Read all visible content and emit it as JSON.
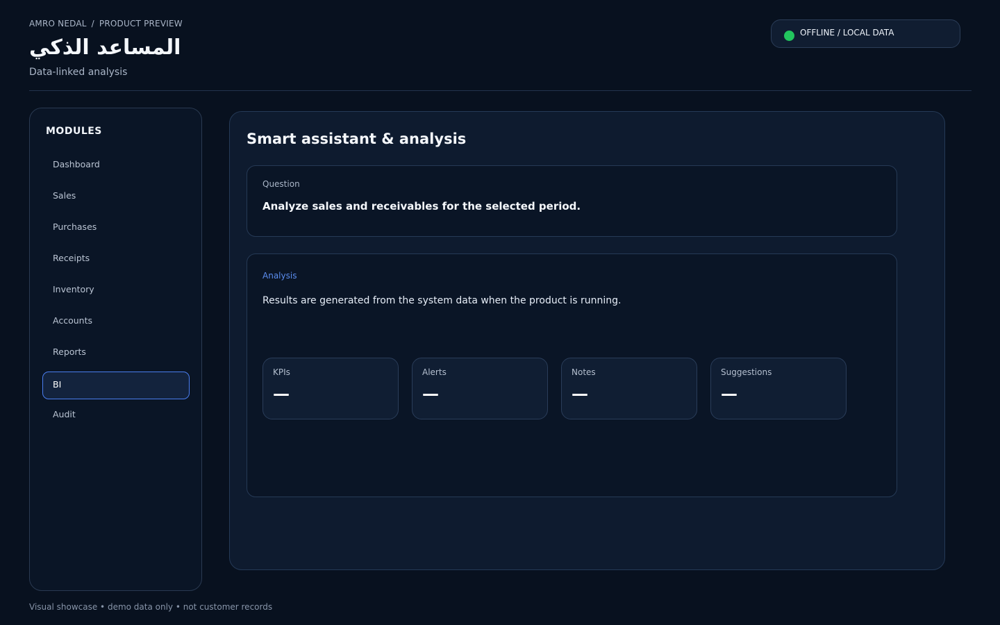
{
  "header": {
    "breadcrumb": [
      "AMRO NEDAL",
      "/",
      "PRODUCT PREVIEW"
    ],
    "title": "المساعد الذكي",
    "subtitle": "Data-linked analysis",
    "status": {
      "label": "OFFLINE / LOCAL DATA",
      "color": "#22c55e"
    }
  },
  "sidebar": {
    "heading": "MODULES",
    "items": [
      {
        "label": "Dashboard",
        "active": false
      },
      {
        "label": "Sales",
        "active": false
      },
      {
        "label": "Purchases",
        "active": false
      },
      {
        "label": "Receipts",
        "active": false
      },
      {
        "label": "Inventory",
        "active": false
      },
      {
        "label": "Accounts",
        "active": false
      },
      {
        "label": "Reports",
        "active": false
      },
      {
        "label": "BI",
        "active": true
      },
      {
        "label": "Audit",
        "active": false
      }
    ]
  },
  "main": {
    "title": "Smart assistant & analysis",
    "question": {
      "label": "Question",
      "text": "Analyze sales and receivables for the selected period."
    },
    "analysis": {
      "label": "Analysis",
      "text": "Results are generated from the system data when the product is running.",
      "metrics": [
        {
          "label": "KPIs",
          "value": "—"
        },
        {
          "label": "Alerts",
          "value": "—"
        },
        {
          "label": "Notes",
          "value": "—"
        },
        {
          "label": "Suggestions",
          "value": "—"
        }
      ]
    }
  },
  "footer": {
    "note": "Visual showcase • demo data only • not customer records"
  },
  "colors": {
    "background": "#08111f",
    "accent": "#4a7ef0",
    "status_online": "#22c55e"
  }
}
